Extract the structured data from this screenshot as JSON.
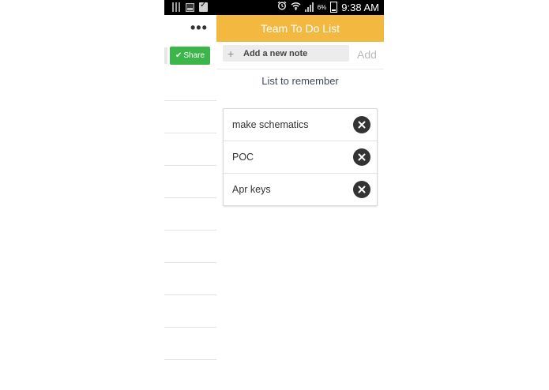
{
  "status_bar": {
    "battery_pct": "6%",
    "time": "9:38 AM",
    "icons": [
      "notes-icon",
      "gallery-icon",
      "bag-check-icon",
      "alarm-icon",
      "wifi-icon",
      "signal-icon",
      "battery-icon"
    ]
  },
  "drawer": {
    "menu_symbol": "•••",
    "share_label": "Share",
    "share_color": "#3cb54a"
  },
  "header": {
    "title": "Team To Do List",
    "color": "#f2b840"
  },
  "add_note": {
    "placeholder": "Add a new note",
    "value": "",
    "add_label": "Add"
  },
  "list": {
    "title": "List to remember",
    "items": [
      {
        "text": "make schematics"
      },
      {
        "text": "POC"
      },
      {
        "text": "Apr keys"
      }
    ]
  }
}
